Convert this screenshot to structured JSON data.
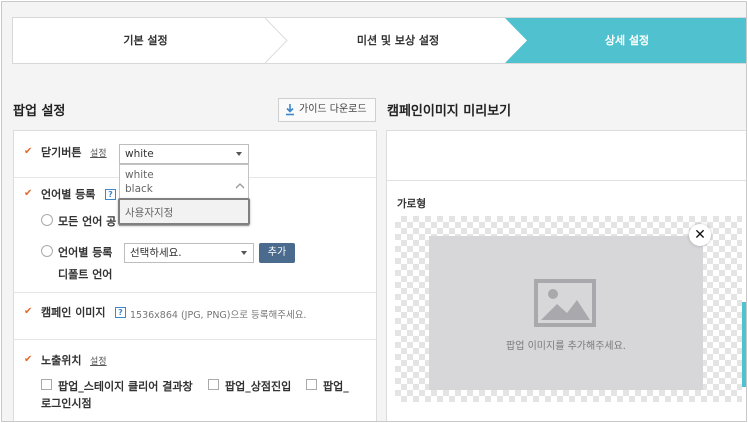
{
  "steps": [
    {
      "label": "기본 설정"
    },
    {
      "label": "미션 및 보상 설정"
    },
    {
      "label": "상세 설정"
    }
  ],
  "colors": {
    "accent": "#4fc1cf",
    "check": "#e3692c",
    "button": "#4a6a8e"
  },
  "popup": {
    "title": "팝업 설정",
    "guide_button": "가이드 다운로드",
    "close_button": {
      "label": "닫기버튼",
      "link": "설정",
      "selected": "white",
      "options": [
        "white",
        "black",
        "사용자지정"
      ],
      "highlighted_option": "사용자지정"
    },
    "language": {
      "label": "언어별 등록",
      "help": "?",
      "all_lang": "모든 언어 공",
      "by_lang": "언어별 등록",
      "select_placeholder": "선택하세요.",
      "add_button": "추가",
      "default_lang": "디폴트 언어"
    },
    "campaign_image": {
      "label": "캠페인 이미지",
      "help": "?",
      "hint": "1536x864 (JPG, PNG)으로 등록해주세요."
    },
    "exposure": {
      "label": "노출위치",
      "link": "설정",
      "options": [
        "팝업_스테이지 클리어 결과창",
        "팝업_상점진입",
        "팝업_"
      ],
      "wrap": "로그인시점"
    }
  },
  "preview": {
    "title": "캠페인이미지 미리보기",
    "landscape": "가로형",
    "placeholder": "팝업 이미지를 추가해주세요.",
    "close": "✕"
  }
}
